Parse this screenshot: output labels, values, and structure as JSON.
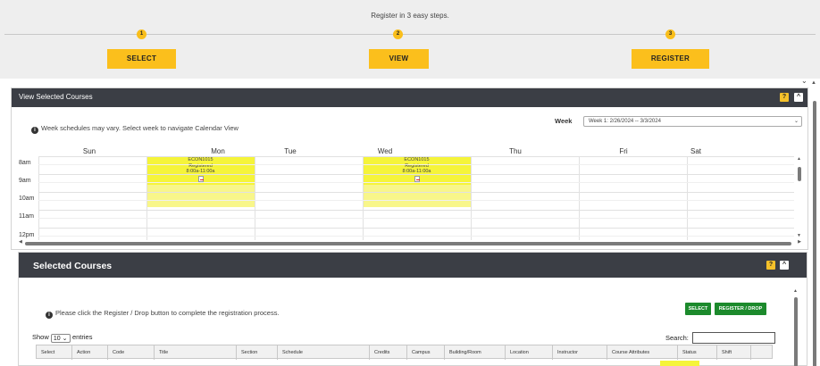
{
  "steps": {
    "title": "Register in 3 easy steps.",
    "items": [
      {
        "number": "1",
        "label": "SELECT"
      },
      {
        "number": "2",
        "label": "VIEW"
      },
      {
        "number": "3",
        "label": "REGISTER"
      }
    ]
  },
  "view_panel": {
    "title": "View Selected Courses",
    "help": "?",
    "collapse": "^",
    "info": "Week schedules may vary. Select week to navigate Calendar View",
    "week_label": "Week",
    "week_value": "Week 1: 2/26/2024 -- 3/3/2024",
    "days": [
      "Sun",
      "Mon",
      "Tue",
      "Wed",
      "Thu",
      "Fri",
      "Sat"
    ],
    "hours": [
      "8am",
      "9am",
      "10am",
      "11am",
      "12pm"
    ],
    "events": [
      {
        "code": "ECON1015",
        "status": "Registered",
        "time": "8:00a-11:00a"
      },
      {
        "code": "ECON1015",
        "status": "Registered",
        "time": "8:00a-11:00a"
      }
    ]
  },
  "selected_panel": {
    "title": "Selected Courses",
    "help": "?",
    "collapse": "^",
    "info": "Please click the Register / Drop button to complete the registration process.",
    "select_button": "SELECT",
    "register_drop_button": "REGISTER / DROP",
    "show_label": "Show",
    "show_value": "10",
    "entries_label": "entries",
    "search_label": "Search:",
    "search_value": "",
    "columns": [
      "Select",
      "Action",
      "Code",
      "Title",
      "Section",
      "Schedule",
      "Credits",
      "Campus",
      "Building/Room",
      "Location",
      "Instructor",
      "Course Attributes",
      "Status",
      "Shift"
    ]
  },
  "colors": {
    "step_yellow": "#fbbf1c",
    "panel_header": "#3b3e45",
    "event_yellow": "#f5f43a",
    "green_button": "#1c8a2c"
  }
}
